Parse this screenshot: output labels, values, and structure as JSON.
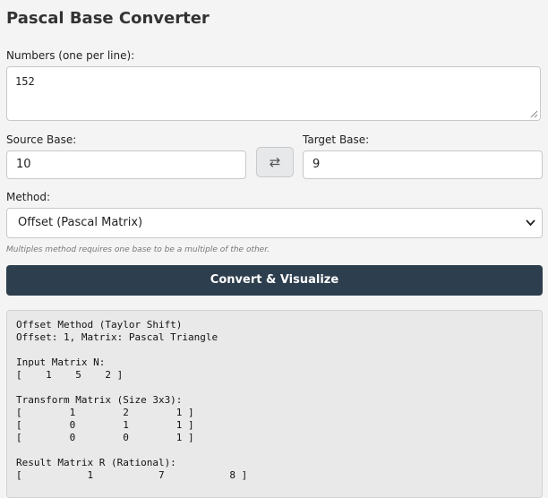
{
  "app": {
    "title": "Pascal Base Converter"
  },
  "numbers": {
    "label": "Numbers (one per line):",
    "value": "152"
  },
  "source_base": {
    "label": "Source Base:",
    "value": "10"
  },
  "target_base": {
    "label": "Target Base:",
    "value": "9"
  },
  "swap": {
    "glyph": "⇄"
  },
  "method": {
    "label": "Method:",
    "selected": "Offset (Pascal Matrix)",
    "hint": "Multiples method requires one base to be a multiple of the other."
  },
  "convert_label": "Convert & Visualize",
  "output": {
    "lines": [
      "Offset Method (Taylor Shift)",
      "Offset: 1, Matrix: Pascal Triangle",
      "",
      "Input Matrix N:",
      "[    1    5    2 ]",
      "",
      "Transform Matrix (Size 3x3):",
      "[        1        2        1 ]",
      "[        0        1        1 ]",
      "[        0        0        1 ]",
      "",
      "Result Matrix R (Rational):",
      "[           1           7           8 ]"
    ]
  }
}
